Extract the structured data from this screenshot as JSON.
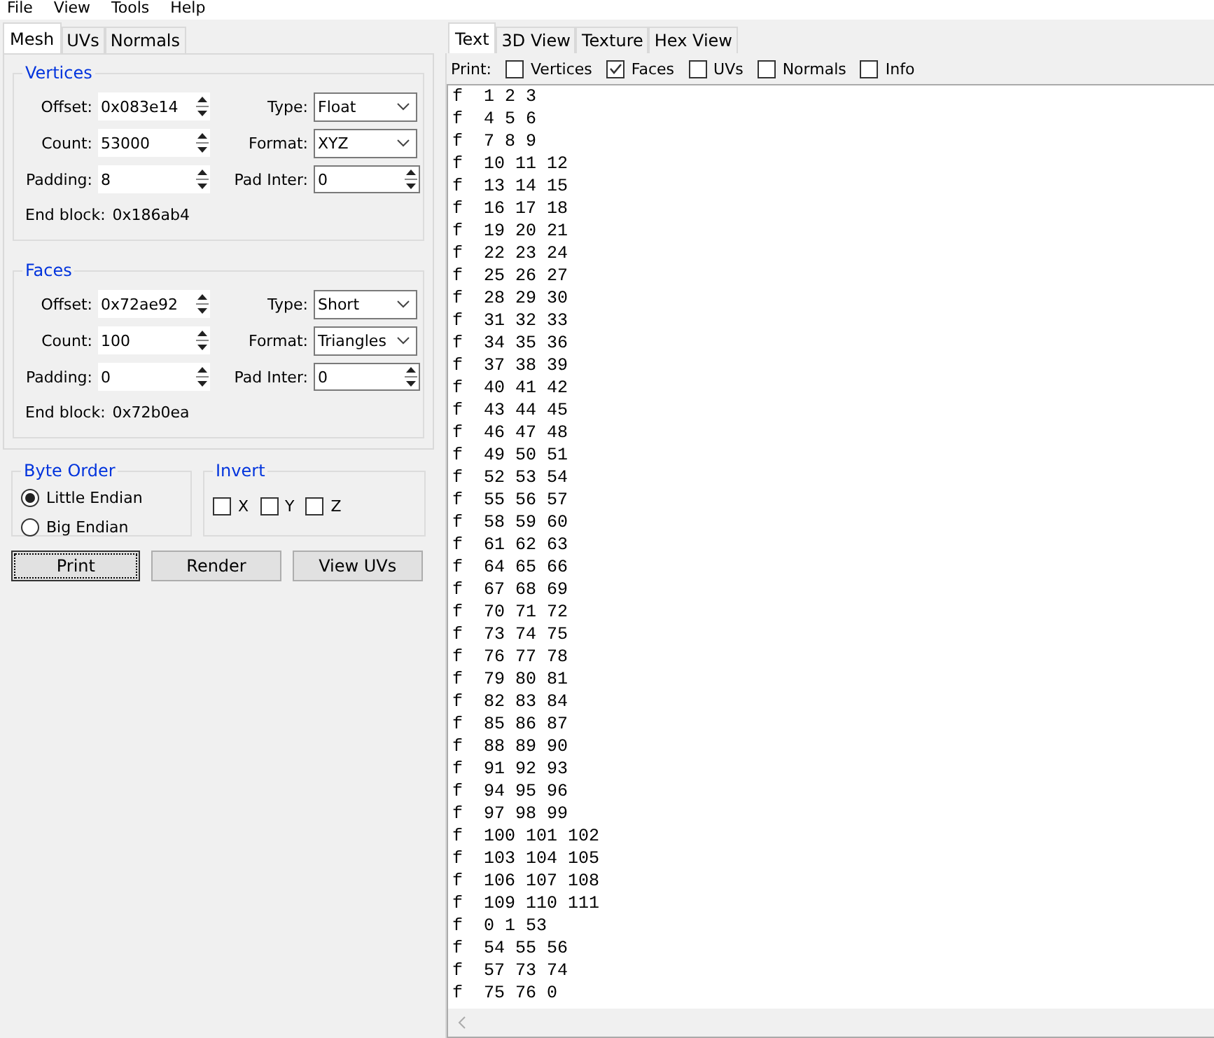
{
  "menu": [
    "File",
    "View",
    "Tools",
    "Help"
  ],
  "left_tabs": [
    {
      "label": "Mesh",
      "selected": true
    },
    {
      "label": "UVs",
      "selected": false
    },
    {
      "label": "Normals",
      "selected": false
    }
  ],
  "groups": [
    {
      "title": "Vertices",
      "rows": [
        [
          {
            "label": "Offset:",
            "value": "0x083e14",
            "kind": "spin"
          },
          {
            "label": "Type:",
            "value": "Float",
            "kind": "combo"
          }
        ],
        [
          {
            "label": "Count:",
            "value": "53000",
            "kind": "spin"
          },
          {
            "label": "Format:",
            "value": "XYZ",
            "kind": "combo"
          }
        ],
        [
          {
            "label": "Padding:",
            "value": "8",
            "kind": "spin"
          },
          {
            "label": "Pad Inter:",
            "value": "0",
            "kind": "spin"
          }
        ]
      ],
      "end_label": "End block:",
      "end_value": "0x186ab4"
    },
    {
      "title": "Faces",
      "rows": [
        [
          {
            "label": "Offset:",
            "value": "0x72ae92",
            "kind": "spin"
          },
          {
            "label": "Type:",
            "value": "Short",
            "kind": "combo"
          }
        ],
        [
          {
            "label": "Count:",
            "value": "100",
            "kind": "spin"
          },
          {
            "label": "Format:",
            "value": "Triangles",
            "kind": "combo"
          }
        ],
        [
          {
            "label": "Padding:",
            "value": "0",
            "kind": "spin"
          },
          {
            "label": "Pad Inter:",
            "value": "0",
            "kind": "spin"
          }
        ]
      ],
      "end_label": "End block:",
      "end_value": "0x72b0ea"
    }
  ],
  "byte_order": {
    "title": "Byte Order",
    "options": [
      {
        "label": "Little Endian",
        "selected": true
      },
      {
        "label": "Big Endian",
        "selected": false
      }
    ]
  },
  "invert": {
    "title": "Invert",
    "options": [
      {
        "label": "X",
        "checked": false
      },
      {
        "label": "Y",
        "checked": false
      },
      {
        "label": "Z",
        "checked": false
      }
    ]
  },
  "buttons": [
    {
      "label": "Print",
      "focused": true
    },
    {
      "label": "Render",
      "focused": false
    },
    {
      "label": "View UVs",
      "focused": false
    }
  ],
  "right_tabs": [
    {
      "label": "Text",
      "selected": true
    },
    {
      "label": "3D View",
      "selected": false
    },
    {
      "label": "Texture",
      "selected": false
    },
    {
      "label": "Hex View",
      "selected": false
    }
  ],
  "print_label": "Print:",
  "print_options": [
    {
      "label": "Vertices",
      "checked": false
    },
    {
      "label": "Faces",
      "checked": true
    },
    {
      "label": "UVs",
      "checked": false
    },
    {
      "label": "Normals",
      "checked": false
    },
    {
      "label": "Info",
      "checked": false
    }
  ],
  "output_lines": [
    "f  1 2 3",
    "f  4 5 6",
    "f  7 8 9",
    "f  10 11 12",
    "f  13 14 15",
    "f  16 17 18",
    "f  19 20 21",
    "f  22 23 24",
    "f  25 26 27",
    "f  28 29 30",
    "f  31 32 33",
    "f  34 35 36",
    "f  37 38 39",
    "f  40 41 42",
    "f  43 44 45",
    "f  46 47 48",
    "f  49 50 51",
    "f  52 53 54",
    "f  55 56 57",
    "f  58 59 60",
    "f  61 62 63",
    "f  64 65 66",
    "f  67 68 69",
    "f  70 71 72",
    "f  73 74 75",
    "f  76 77 78",
    "f  79 80 81",
    "f  82 83 84",
    "f  85 86 87",
    "f  88 89 90",
    "f  91 92 93",
    "f  94 95 96",
    "f  97 98 99",
    "f  100 101 102",
    "f  103 104 105",
    "f  106 107 108",
    "f  109 110 111",
    "f  0 1 53",
    "f  54 55 56",
    "f  57 73 74",
    "f  75 76 0"
  ]
}
